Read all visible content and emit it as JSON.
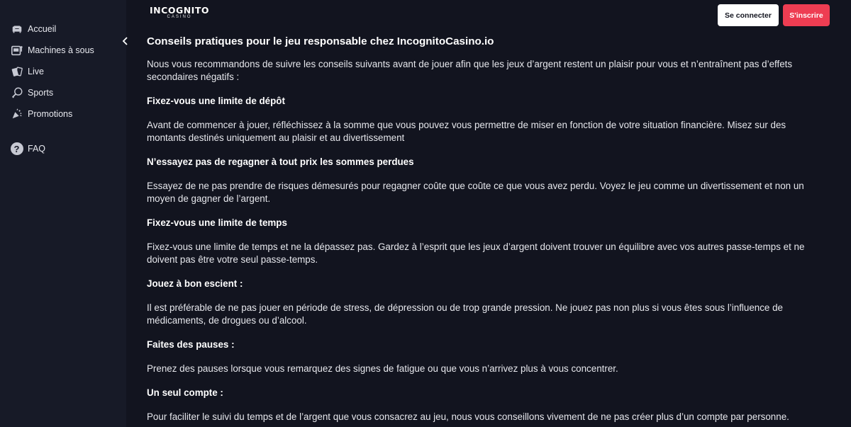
{
  "sidebar": {
    "items": [
      {
        "label": "Accueil",
        "icon": "sofa-icon"
      },
      {
        "label": "Machines à sous",
        "icon": "slot-machine-icon"
      },
      {
        "label": "Live",
        "icon": "cards-icon"
      },
      {
        "label": "Sports",
        "icon": "ball-icon"
      },
      {
        "label": "Promotions",
        "icon": "party-popper-icon"
      }
    ],
    "faq": {
      "label": "FAQ",
      "icon": "question-icon"
    }
  },
  "header": {
    "logo_main": "INCOGNITO",
    "logo_sub": "CASINO",
    "login_label": "Se connecter",
    "register_label": "S'inscrire"
  },
  "article": {
    "title": "Conseils pratiques pour le jeu responsable chez IncognitoCasino.io",
    "intro": "Nous vous recommandons de suivre les conseils suivants avant de jouer afin que les jeux d’argent restent un plaisir pour vous et n’entraînent pas d’effets secondaires négatifs :",
    "sections": [
      {
        "heading": "Fixez-vous une limite de dépôt",
        "text": "Avant de commencer à jouer, réfléchissez à la somme que vous pouvez vous permettre de miser en fonction de votre situation financière. Misez sur des montants destinés uniquement au plaisir et au divertissement"
      },
      {
        "heading": "N’essayez pas de regagner à tout prix les sommes perdues",
        "text": "Essayez de ne pas prendre de risques démesurés pour regagner coûte que coûte ce que vous avez perdu. Voyez le jeu comme un divertissement et non un moyen de gagner de l’argent."
      },
      {
        "heading": "Fixez-vous une limite de temps",
        "text": "Fixez-vous une limite de temps et ne la dépassez pas. Gardez à l’esprit que les jeux d’argent doivent trouver un équilibre avec vos autres passe-temps et ne doivent pas être votre seul passe-temps."
      },
      {
        "heading": "Jouez à bon escient :",
        "text": "Il est préférable de ne pas jouer en période de stress, de dépression ou de trop grande pression. Ne jouez pas non plus si vous êtes sous l’influence de médicaments, de drogues ou d’alcool."
      },
      {
        "heading": "Faites des pauses :",
        "text": "Prenez des pauses lorsque vous remarquez des signes de fatigue ou que vous n’arrivez plus à vous concentrer."
      },
      {
        "heading": "Un seul compte :",
        "text": "Pour faciliter le suivi du temps et de l’argent que vous consacrez au jeu, nous vous conseillons vivement de ne pas créer plus d’un compte par personne."
      }
    ]
  },
  "colors": {
    "page_bg": "#12141f",
    "sidebar_bg": "#171a27",
    "register_button": "#ee3d52",
    "login_button": "#ffffff"
  }
}
